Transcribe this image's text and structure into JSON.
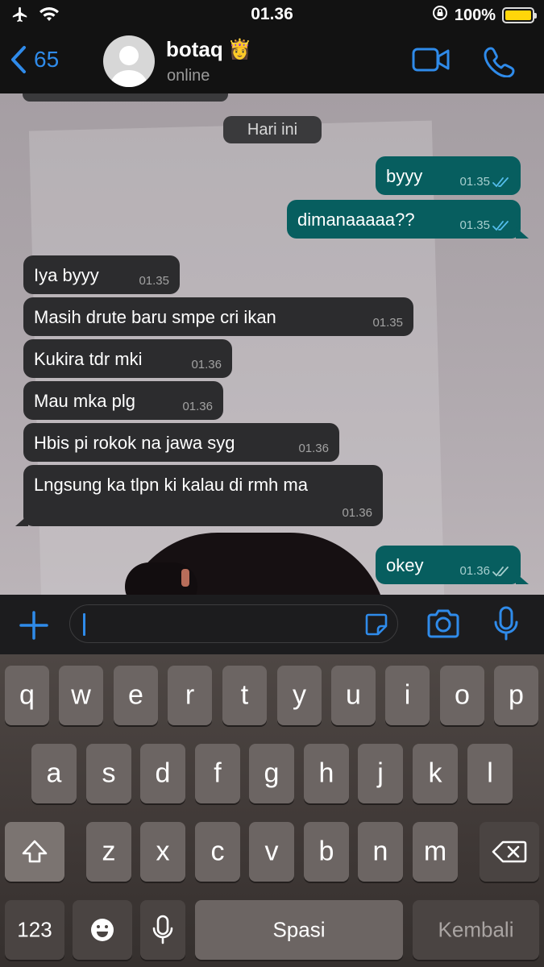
{
  "status_bar": {
    "time": "01.36",
    "battery_percent": "100%",
    "icons": [
      "airplane-icon",
      "wifi-icon",
      "orientation-lock-icon",
      "battery-icon"
    ]
  },
  "header": {
    "back_count": "65",
    "contact_name": "botaq",
    "contact_emoji": "👸",
    "contact_status": "online",
    "accent_color": "#2f8bea"
  },
  "chat": {
    "date_chip": "Hari ini",
    "messages": [
      {
        "dir": "out",
        "text": "byyy",
        "time": "01.35",
        "read": true
      },
      {
        "dir": "out",
        "text": "dimanaaaaa??",
        "time": "01.35",
        "read": true
      },
      {
        "dir": "in",
        "text": "Iya byyy",
        "time": "01.35"
      },
      {
        "dir": "in",
        "text": "Masih drute baru smpe cri ikan",
        "time": "01.35"
      },
      {
        "dir": "in",
        "text": "Kukira tdr mki",
        "time": "01.36"
      },
      {
        "dir": "in",
        "text": "Mau mka plg",
        "time": "01.36"
      },
      {
        "dir": "in",
        "text": "Hbis pi rokok na jawa syg",
        "time": "01.36"
      },
      {
        "dir": "in",
        "text": "Lngsung ka tlpn ki kalau di rmh ma",
        "time": "01.36"
      },
      {
        "dir": "out",
        "text": "okey",
        "time": "01.36",
        "read": false
      }
    ]
  },
  "input": {
    "value": ""
  },
  "keyboard": {
    "row1": [
      "q",
      "w",
      "e",
      "r",
      "t",
      "y",
      "u",
      "i",
      "o",
      "p"
    ],
    "row2": [
      "a",
      "s",
      "d",
      "f",
      "g",
      "h",
      "j",
      "k",
      "l"
    ],
    "row3": [
      "z",
      "x",
      "c",
      "v",
      "b",
      "n",
      "m"
    ],
    "numbers_label": "123",
    "space_label": "Spasi",
    "return_label": "Kembali"
  },
  "colors": {
    "outgoing_bubble": "#075e5f",
    "incoming_bubble": "#2c2c2e",
    "read_ticks": "#53bdeb"
  }
}
